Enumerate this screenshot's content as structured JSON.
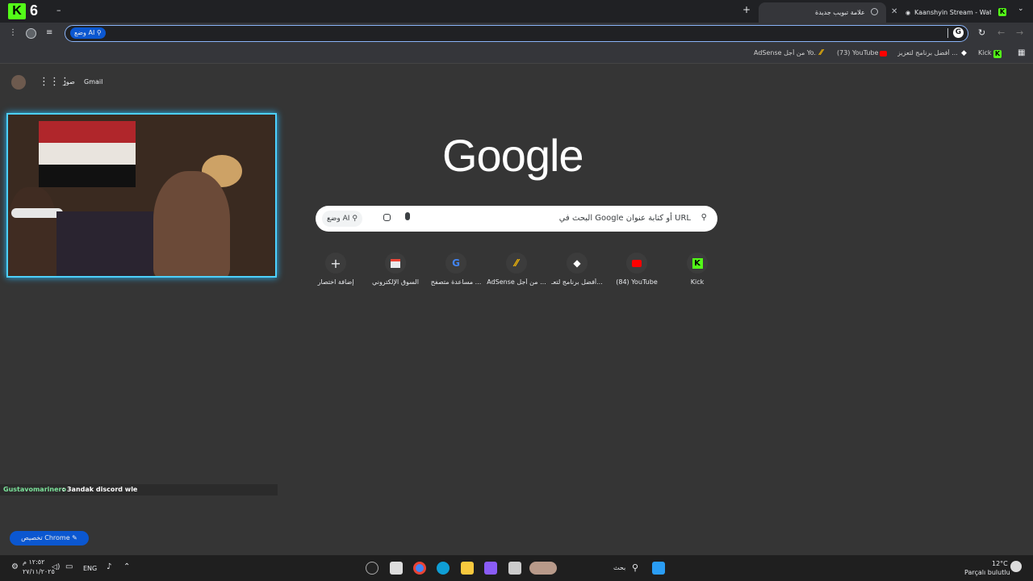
{
  "tabs": [
    {
      "title": "Kaanshyin Stream - Watch L",
      "active": false
    },
    {
      "title": "علامة تبويب جديدة",
      "active": true
    }
  ],
  "toolbar": {
    "omnibox_pill": "وضع AI"
  },
  "bookmarks": [
    {
      "label": "Kick",
      "icon": "kick-icon"
    },
    {
      "label": "أفضل برنامج لتعزيز ...",
      "icon": "diamond-icon"
    },
    {
      "label": "(73) YouTube",
      "icon": "youtube-icon"
    },
    {
      "label": "AdSense من أجل Yo...",
      "icon": "adsense-icon"
    }
  ],
  "ntp": {
    "topbar": {
      "gmail": "Gmail",
      "images": "صور"
    },
    "logo": "Google",
    "search_placeholder": "البحث في Google أو كتابة عنوان URL",
    "ai_mode": "وضع AI",
    "shortcuts": [
      {
        "label": "إضافة اختصار",
        "icon": "plus-icon"
      },
      {
        "label": "السوق الإلكتروني",
        "icon": "store-icon"
      },
      {
        "label": "مساعدة متصفح ...",
        "icon": "google-g-icon"
      },
      {
        "label": "AdSense من أجل ...",
        "icon": "adsense-icon"
      },
      {
        "label": "أفضل برنامج لتعـ...",
        "icon": "diamond-icon"
      },
      {
        "label": "(84) YouTube",
        "icon": "youtube-icon"
      },
      {
        "label": "Kick",
        "icon": "kick-icon"
      }
    ],
    "customize": "تخصيص Chrome"
  },
  "stream": {
    "channel_number": "6",
    "chat": {
      "user": "Gustavomarinero",
      "message": " : 3andak discord wle"
    }
  },
  "taskbar": {
    "search_label": "بحث",
    "lang": "ENG",
    "time": "١٢:٥٢ م",
    "date": "٢٧/١١/٢٠٢٥",
    "weather_temp": "12°C",
    "weather_desc": "Parçalı bulutlu"
  },
  "colors": {
    "accent": "#0b57d0",
    "kick": "#53fc18",
    "webcam_border": "#4dd0ff"
  }
}
